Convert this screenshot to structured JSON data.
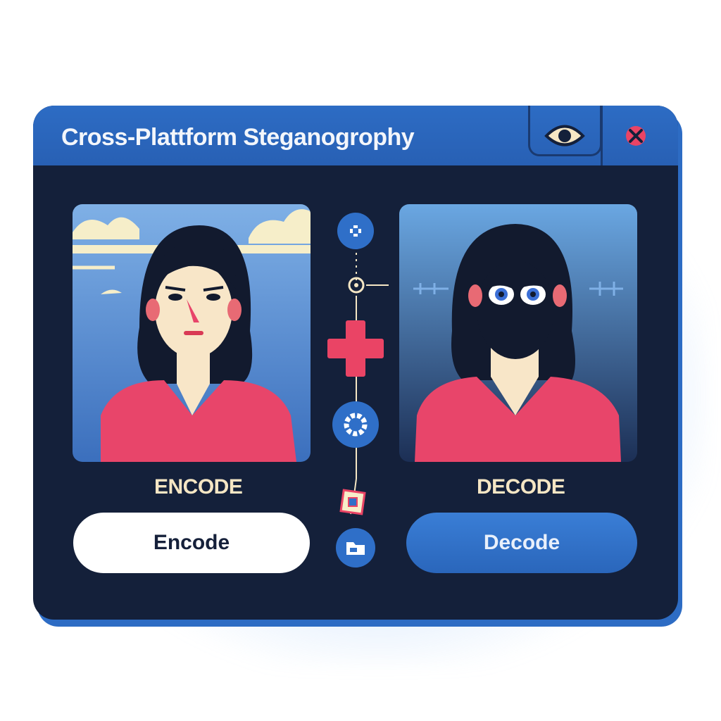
{
  "window": {
    "title": "Cross-Plattform Steganogrophy"
  },
  "titlebar_icons": {
    "view": "eye-icon",
    "close": "close-icon"
  },
  "panels": {
    "encode": {
      "label": "ENCODE",
      "button_label": "Encode"
    },
    "decode": {
      "label": "DECODE",
      "button_label": "Decode"
    }
  },
  "center_icons": [
    "add-icon",
    "node-icon",
    "plus-icon",
    "settings-icon",
    "embed-icon",
    "folder-icon"
  ],
  "colors": {
    "window_bg": "#14203a",
    "titlebar": "#2d6cc4",
    "accent_red": "#ea4465",
    "button_blue": "#2f6fc8",
    "label_cream": "#f5e6c4"
  }
}
